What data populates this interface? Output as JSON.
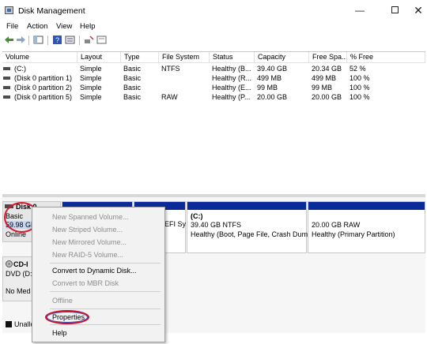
{
  "window": {
    "title": "Disk Management",
    "minimize": "—",
    "maximize": "",
    "close": "✕"
  },
  "menu": [
    "File",
    "Action",
    "View",
    "Help"
  ],
  "toolbar": [
    "back-icon",
    "forward-icon",
    "console-tree-icon",
    "help-icon",
    "properties-icon",
    "rescan-icon",
    "open-icon"
  ],
  "list": {
    "headers": [
      "Volume",
      "Layout",
      "Type",
      "File System",
      "Status",
      "Capacity",
      "Free Spa...",
      "% Free"
    ],
    "rows": [
      [
        "(C:)",
        "Simple",
        "Basic",
        "NTFS",
        "Healthy (B...",
        "39.40 GB",
        "20.34 GB",
        "52 %"
      ],
      [
        "(Disk 0 partition 1)",
        "Simple",
        "Basic",
        "",
        "Healthy (R...",
        "499 MB",
        "499 MB",
        "100 %"
      ],
      [
        "(Disk 0 partition 2)",
        "Simple",
        "Basic",
        "",
        "Healthy (E...",
        "99 MB",
        "99 MB",
        "100 %"
      ],
      [
        "(Disk 0 partition 5)",
        "Simple",
        "Basic",
        "RAW",
        "Healthy (P...",
        "20.00 GB",
        "20.00 GB",
        "100 %"
      ]
    ]
  },
  "disk0": {
    "name": "Disk 0",
    "type": "Basic",
    "size": "59.98 GE",
    "status": "Online"
  },
  "cdrom": {
    "name": "CD-I",
    "drive": "DVD (D:",
    "media": "No Med"
  },
  "partitions": {
    "efi_text": "EFI Sy",
    "c": {
      "name": "(C:)",
      "size": "39.40 GB NTFS",
      "status": "Healthy (Boot, Page File, Crash Dump"
    },
    "p5": {
      "size": "20.00 GB RAW",
      "status": "Healthy (Primary Partition)"
    }
  },
  "context_menu": {
    "items": [
      {
        "label": "New Spanned Volume...",
        "enabled": false
      },
      {
        "label": "New Striped Volume...",
        "enabled": false
      },
      {
        "label": "New Mirrored Volume...",
        "enabled": false
      },
      {
        "label": "New RAID-5 Volume...",
        "enabled": false
      },
      {
        "label": "Convert to Dynamic Disk...",
        "enabled": true
      },
      {
        "label": "Convert to MBR Disk",
        "enabled": false
      },
      {
        "label": "Offline",
        "enabled": false
      },
      {
        "label": "Properties",
        "enabled": true
      },
      {
        "label": "Help",
        "enabled": true
      }
    ]
  },
  "status": {
    "legend": "Unallo"
  },
  "colors": {
    "partition_bar": "#0b2a9a",
    "highlight_ellipse": "#e0142d",
    "disk_selected": "#c7d7f2"
  }
}
